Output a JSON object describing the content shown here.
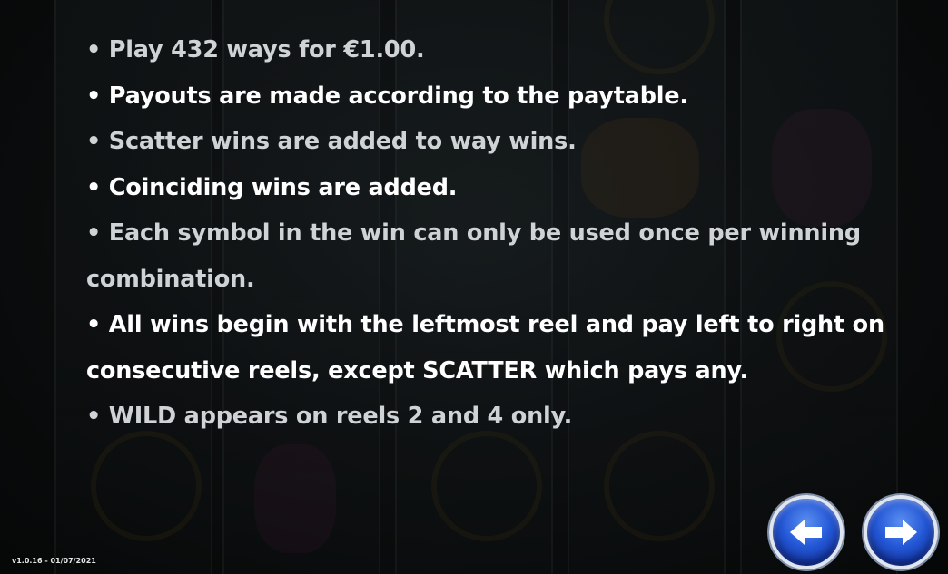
{
  "rules": [
    {
      "text": "• Play 432 ways for €1.00.",
      "tone": "dim"
    },
    {
      "text": "• Payouts are made according to the paytable.",
      "tone": "bright"
    },
    {
      "text": "• Scatter wins are added to way wins.",
      "tone": "dim"
    },
    {
      "text": "• Coinciding wins are added.",
      "tone": "bright"
    },
    {
      "text": "• Each symbol in the win can only be used once per winning",
      "tone": "dim"
    },
    {
      "text": "combination.",
      "tone": "dim"
    },
    {
      "text": "• All wins begin with the leftmost reel and pay left to right on",
      "tone": "bright"
    },
    {
      "text": "consecutive reels, except SCATTER which pays any.",
      "tone": "bright"
    },
    {
      "text": "• WILD appears on reels 2 and 4 only.",
      "tone": "dim"
    }
  ],
  "nav": {
    "prev_icon": "arrow-left-icon",
    "next_icon": "arrow-right-icon"
  },
  "version": "v1.0.16 - 01/07/2021",
  "colors": {
    "background": "#0a0c0d",
    "text_bright": "#ffffff",
    "text_dim": "#cfd3d6",
    "button_blue": "#2457d6"
  }
}
